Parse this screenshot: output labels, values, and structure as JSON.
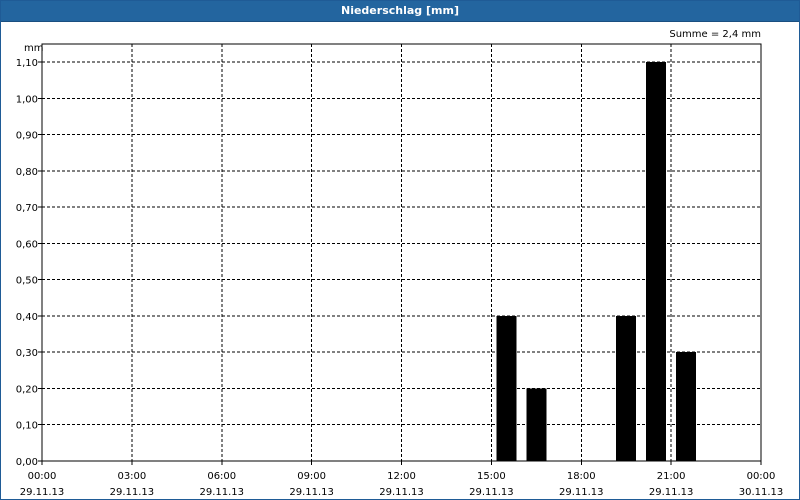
{
  "window": {
    "title": "Niederschlag [mm]"
  },
  "chart_data": {
    "type": "bar",
    "title": "Niederschlag [mm]",
    "ylabel": "mm",
    "ylim": [
      0,
      1.1
    ],
    "yticks": [
      "0,00",
      "0,10",
      "0,20",
      "0,30",
      "0,40",
      "0,50",
      "0,60",
      "0,70",
      "0,80",
      "0,90",
      "1,00",
      "1,10"
    ],
    "xlim_hours": [
      0,
      24
    ],
    "xticks": [
      {
        "time": "00:00",
        "date": "29.11.13"
      },
      {
        "time": "03:00",
        "date": "29.11.13"
      },
      {
        "time": "06:00",
        "date": "29.11.13"
      },
      {
        "time": "09:00",
        "date": "29.11.13"
      },
      {
        "time": "12:00",
        "date": "29.11.13"
      },
      {
        "time": "15:00",
        "date": "29.11.13"
      },
      {
        "time": "18:00",
        "date": "29.11.13"
      },
      {
        "time": "21:00",
        "date": "29.11.13"
      },
      {
        "time": "00:00",
        "date": "30.11.13"
      }
    ],
    "bar_color": "#000000",
    "grid": true,
    "summary": "Summe = 2,4 mm",
    "series": [
      {
        "values": [
          {
            "time": "16:00",
            "value": 0.4
          },
          {
            "time": "17:00",
            "value": 0.2
          },
          {
            "time": "20:00",
            "value": 0.4
          },
          {
            "time": "21:00",
            "value": 1.1
          },
          {
            "time": "22:00",
            "value": 0.3
          }
        ]
      }
    ]
  }
}
